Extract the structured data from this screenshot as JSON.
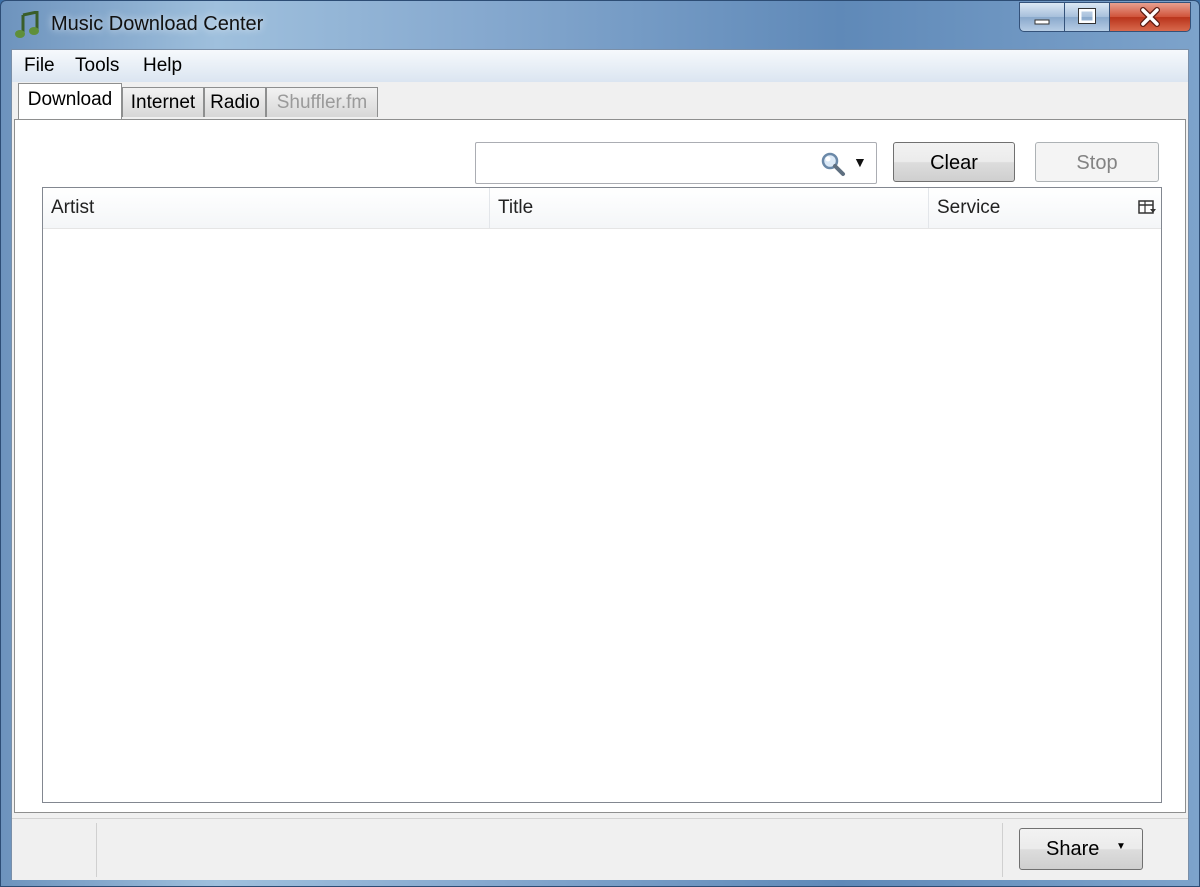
{
  "window": {
    "title": "Music Download Center"
  },
  "menu": {
    "file": "File",
    "tools": "Tools",
    "help": "Help"
  },
  "tabs": [
    {
      "label": "Download",
      "state": "active"
    },
    {
      "label": "Internet",
      "state": "normal"
    },
    {
      "label": "Radio",
      "state": "normal"
    },
    {
      "label": "Shuffler.fm",
      "state": "disabled"
    }
  ],
  "search": {
    "value": "",
    "placeholder": ""
  },
  "toolbar": {
    "clear_label": "Clear",
    "stop_label": "Stop"
  },
  "list": {
    "columns": [
      "Artist",
      "Title",
      "Service"
    ],
    "rows": []
  },
  "footer": {
    "share_label": "Share"
  },
  "icons": {
    "app": "music-note-icon",
    "search": "magnifier-icon",
    "dropdown": "chevron-down-icon",
    "columns": "column-chooser-icon"
  },
  "colors": {
    "title_bar": "#6d93bd",
    "close_button": "#c9452b",
    "accent": "#3c6fa6"
  }
}
